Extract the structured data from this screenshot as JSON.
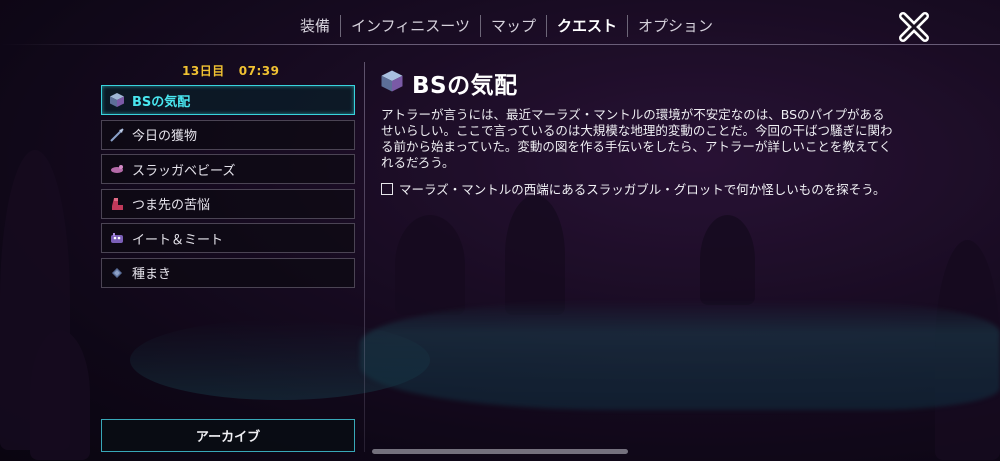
{
  "nav": {
    "tabs": [
      {
        "label": "装備"
      },
      {
        "label": "インフィニスーツ"
      },
      {
        "label": "マップ"
      },
      {
        "label": "クエスト",
        "active": true
      },
      {
        "label": "オプション"
      }
    ]
  },
  "status": {
    "day": "13日目",
    "time": "07:39"
  },
  "quests": [
    {
      "label": "BSの気配",
      "icon": "cube-icon",
      "selected": true
    },
    {
      "label": "今日の獲物",
      "icon": "spear-icon"
    },
    {
      "label": "スラッガベビーズ",
      "icon": "slug-icon"
    },
    {
      "label": "つま先の苦悩",
      "icon": "boot-icon"
    },
    {
      "label": "イート＆ミート",
      "icon": "creature-icon"
    },
    {
      "label": "種まき",
      "icon": "seed-icon"
    }
  ],
  "archive_label": "アーカイブ",
  "detail": {
    "title": "BSの気配",
    "description": "アトラーが言うには、最近マーラズ・マントルの環境が不安定なのは、BSのパイプがあるせいらしい。ここで言っているのは大規模な地理的変動のことだ。今回の干ばつ騒ぎに関わる前から始まっていた。変動の図を作る手伝いをしたら、アトラーが詳しいことを教えてくれるだろう。",
    "objectives": [
      {
        "text": "マーラズ・マントルの西端にあるスラッガブル・グロットで何か怪しいものを探そう。",
        "done": false
      }
    ]
  },
  "colors": {
    "accent": "#38d3dd",
    "time": "#f1c232",
    "text": "#e8e8ee"
  }
}
